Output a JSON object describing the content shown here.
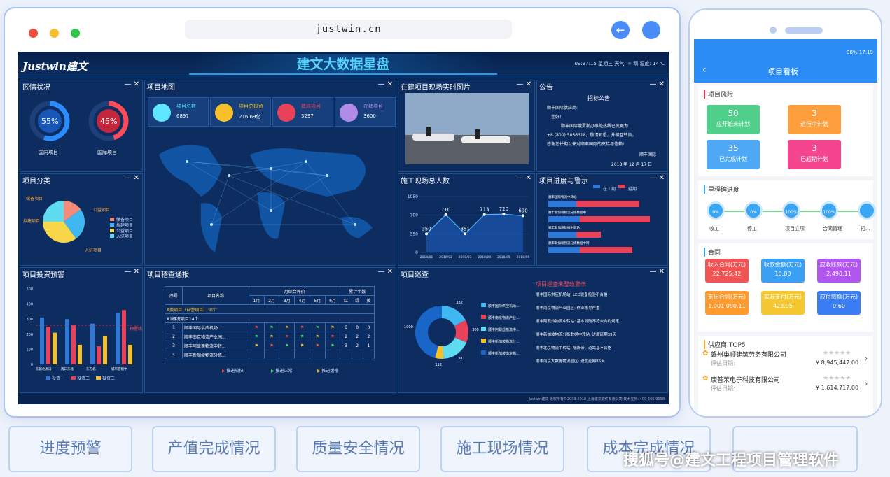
{
  "browser": {
    "url": "justwin.cn"
  },
  "dashboard": {
    "logo": "Justwin建文",
    "title": "建文大数据星盘",
    "info": "09:37:15  星期三  天气: ☼ 晴  温度: 14℃",
    "regional": {
      "title": "区情状况",
      "domestic_pct": "55%",
      "domestic_label": "国内项目",
      "intl_pct": "45%",
      "intl_label": "国际项目"
    },
    "map": {
      "title": "项目地图",
      "stats": [
        {
          "label": "项目总数",
          "value": "6897",
          "color": "#5ee6ff"
        },
        {
          "label": "项目总投资",
          "value": "216.69亿",
          "color": "#f6c02b"
        },
        {
          "label": "建成项目",
          "value": "3297",
          "color": "#e8415a"
        },
        {
          "label": "在建项目",
          "value": "3600",
          "color": "#b08ce8"
        }
      ]
    },
    "site_photo": {
      "title": "在建项目现场实时图片"
    },
    "notice": {
      "title": "公告",
      "heading": "招标公告",
      "to": "顺丰国际供应商:",
      "greet": "您好!",
      "lines": [
        "顺丰国际俄罗斯办事处热线已变更为",
        "+8 (800) 5056318，敬请知悉，并相互转告。",
        "感谢您长期以来对顺丰国际的支持与信赖!"
      ],
      "sign": "顺丰国际",
      "date": "2018 年 12 月 17 日"
    },
    "category": {
      "title": "项目分类",
      "labels": [
        "储备项目",
        "拟建项目",
        "公益项目",
        "入驻项目"
      ],
      "legend": [
        "储备项目",
        "拟建项目",
        "公益项目",
        "入驻项目"
      ]
    },
    "workers": {
      "title": "施工现场总人数"
    },
    "progress": {
      "title": "项目进度与警示",
      "legend": [
        "在工期",
        "延期"
      ],
      "bar_labels": [
        "顺丰国际物流中转站",
        "顺丰新加坡物流分拣数据中",
        "顺丰新加坡数据中转站",
        "顺丰新加坡物流分拣数据中转"
      ]
    },
    "invest": {
      "title": "项目投资预警",
      "legend": [
        "投资一",
        "投资二",
        "投资三"
      ],
      "xticks": [
        "东新北周口",
        "两口东北",
        "东方北",
        "城市管理中"
      ],
      "yticks": [
        "500",
        "400",
        "300",
        "200",
        "100",
        "0"
      ],
      "warn": "预警线"
    },
    "supervise": {
      "title": "项目稽查通报",
      "head1": [
        "序号",
        "项目名称",
        "月综合评价",
        "累计个数"
      ],
      "months": [
        "1月",
        "2月",
        "3月",
        "4月",
        "5月",
        "6月"
      ],
      "colors": [
        "红",
        "绿",
        "黄"
      ],
      "group": "A类项目（自營項目）30个",
      "sub": "A1概况项目14个",
      "rows": [
        {
          "no": "1",
          "name": "顺丰国际供应机场...",
          "r": "6",
          "g": "0",
          "y": "0"
        },
        {
          "no": "2",
          "name": "顺丰南京物流产业园...",
          "r": "2",
          "g": "2",
          "y": "2"
        },
        {
          "no": "3",
          "name": "顺丰阿联酋物流中转...",
          "r": "3",
          "g": "2",
          "y": "1"
        },
        {
          "no": "4",
          "name": "顺丰新加坡物流分拣...",
          "r": "",
          "g": "",
          "y": ""
        }
      ],
      "legend": [
        "推进较快",
        "推进正常",
        "推进缓慢"
      ]
    },
    "patrol": {
      "title": "项目巡查",
      "alert_title": "项目巡查未整改警示",
      "alerts": [
        "顺丰国际供应机场站: LED设备检验不合格",
        "顺丰南京物流产业园区: 作业帐尽严重",
        "顺丰阿联酋物流中转站: 基本消防不符合合约规定",
        "顺丰新加坡物流分拣数据中转站: 进度延期35天",
        "顺丰北京物流中转站: 隔离带、道路基不合格",
        "顺丰南京大数据物流园区: 进度延期85天"
      ],
      "legend": [
        "顺丰国际供应机场...",
        "顺丰南京物流产业...",
        "顺丰阿联酋物流中...",
        "顺丰新加坡物流分...",
        "顺丰新加坡南京物..."
      ]
    },
    "footer": "Justwin建文  版权所有©2003-2018 上海建文软件有限公司  技术支持: 400-666-9998"
  },
  "chart_data": [
    {
      "type": "pie",
      "title": "区情状况",
      "series": [
        {
          "name": "国内项目",
          "values": [
            55
          ]
        },
        {
          "name": "国际项目",
          "values": [
            45
          ]
        }
      ]
    },
    {
      "type": "pie",
      "title": "项目分类",
      "categories": [
        "储备项目",
        "拟建项目",
        "公益项目",
        "入驻项目"
      ],
      "values": [
        15,
        25,
        35,
        25
      ]
    },
    {
      "type": "line",
      "title": "施工现场总人数",
      "categories": [
        "2018/01",
        "2018/02",
        "2018/03",
        "2018/04",
        "2018/05",
        "2018/06"
      ],
      "values": [
        350,
        710,
        351,
        713,
        720,
        690
      ],
      "ylim": [
        0,
        1050
      ],
      "yticks": [
        0,
        350,
        700,
        1050
      ]
    },
    {
      "type": "bar",
      "title": "项目进度与警示",
      "categories": [
        "顺丰国际物流中转站",
        "顺丰新加坡物流分拣数据中",
        "顺丰新加坡数据中转站",
        "顺丰新加坡物流分拣数据中转"
      ],
      "series": [
        {
          "name": "在工期",
          "values": [
            40,
            45,
            40,
            45
          ]
        },
        {
          "name": "延期",
          "values": [
            90,
            100,
            35,
            75
          ]
        }
      ]
    },
    {
      "type": "bar",
      "title": "项目投资预警",
      "categories": [
        "东新北周口",
        "两口东北",
        "东方北",
        "城市管理中"
      ],
      "series": [
        {
          "name": "投资一",
          "values": [
            310,
            300,
            270,
            340
          ]
        },
        {
          "name": "投资二",
          "values": [
            250,
            260,
            120,
            360
          ]
        },
        {
          "name": "投资三",
          "values": [
            210,
            130,
            190,
            130
          ]
        }
      ],
      "ylim": [
        0,
        500
      ]
    },
    {
      "type": "pie",
      "title": "项目巡查",
      "categories": [
        "顺丰国际供应机场...",
        "顺丰南京物流产业...",
        "顺丰阿联酋物流中...",
        "顺丰新加坡物流分...",
        "顺丰新加坡南京物..."
      ],
      "values": [
        382,
        300,
        387,
        112,
        1000
      ]
    }
  ],
  "phone": {
    "status": "38% 17:19",
    "title": "项目看板",
    "risk": {
      "title": "项目风险",
      "items": [
        {
          "n": "50",
          "s": "应开始未计划",
          "color": "#4fcf8a"
        },
        {
          "n": "3",
          "s": "进行中计划",
          "color": "#ff9e3d"
        },
        {
          "n": "35",
          "s": "已完成计划",
          "color": "#4ea8f5"
        },
        {
          "n": "3",
          "s": "已超期计划",
          "color": "#f5458e"
        }
      ]
    },
    "milestone": {
      "title": "里程碑进度",
      "items": [
        {
          "pct": "0%",
          "label": "收工"
        },
        {
          "pct": "0%",
          "label": "停工"
        },
        {
          "pct": "100%",
          "label": "项目立项"
        },
        {
          "pct": "100%",
          "label": "合同管理"
        },
        {
          "pct": "",
          "label": "招..."
        }
      ]
    },
    "contract": {
      "title": "合同",
      "items": [
        {
          "label": "收入合同(万元)",
          "value": "22,725.42",
          "color": "#f05454"
        },
        {
          "label": "收款金额(万元)",
          "value": "10.00",
          "color": "#3ba0f3"
        },
        {
          "label": "应收账款(万元)",
          "value": "2,490.11",
          "color": "#b256f0"
        },
        {
          "label": "支出合同(万元)",
          "value": "1,001,080.11",
          "color": "#ff9a2e"
        },
        {
          "label": "实际支付(万元)",
          "value": "423.95",
          "color": "#f5c832"
        },
        {
          "label": "应付款额(万元)",
          "value": "0.60",
          "color": "#3b7ef3"
        }
      ]
    },
    "suppliers": {
      "title": "供应商 TOP5",
      "items": [
        {
          "name": "赣州巢顺建筑劳务有限公司",
          "date": "评估日期:",
          "amount": "¥ 8,945,447.00"
        },
        {
          "name": "康普莱电子科技有限公司",
          "date": "评估日期:",
          "amount": "¥ 1,614,717.00"
        }
      ]
    }
  },
  "bottom_buttons": [
    "进度预警",
    "产值完成情况",
    "质量安全情况",
    "施工现场情况",
    "成本完成情况",
    ""
  ],
  "watermark": "搜狐号@建文工程项目管理软件"
}
